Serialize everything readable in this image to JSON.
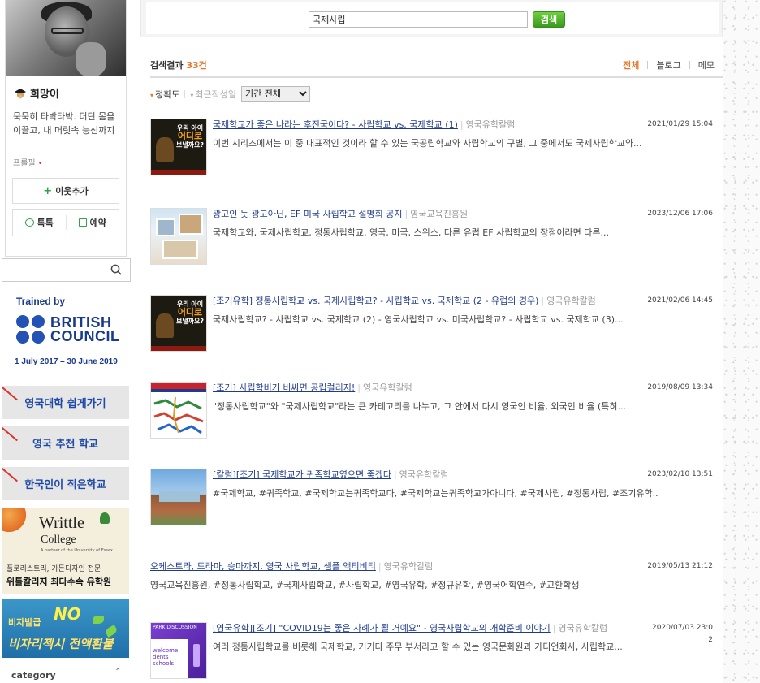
{
  "sidebar": {
    "profile": {
      "name": "희망이",
      "description": "묵묵히 타박타박. 더딘 몸을 이끌고, 내 머릿속 능선까지",
      "profile_link": "프롤필"
    },
    "buttons": {
      "add_neighbor": "이웃추가",
      "talk": "톡톡",
      "reserve": "예약"
    },
    "search": {
      "value": ""
    },
    "trained": {
      "line1": "Trained by",
      "brand1": "BRITISH",
      "brand2": "COUNCIL",
      "dates": "1 July 2017 – 30 June 2019",
      "brand_color": "#2451b4"
    },
    "links": [
      "영국대학 쉽게가기",
      "영국 추천 학교",
      "한국인이 적은학교"
    ],
    "banner_writtle": {
      "title1": "Writtle",
      "title2": "College",
      "sub": "A partner of the University of Essex",
      "line1": "플로리스트리, 가든디자인 전문",
      "line2": "위틀칼리지 최다수속 유학원"
    },
    "banner_visa": {
      "line1": "비자발급",
      "line2": "NO",
      "line3": "비자리젝시 전액환불"
    },
    "category": {
      "label": "category",
      "caret": "⌃"
    }
  },
  "search_bar": {
    "value": "국제사립",
    "button": "검색",
    "accent": "#4aa82a"
  },
  "results": {
    "label": "검색결과",
    "count": "33건",
    "tabs": [
      "전체",
      "블로그",
      "메모"
    ],
    "sort": {
      "accuracy": "정확도",
      "recent": "최근작성일",
      "period": "기간 전체"
    },
    "accent": "#e8762c"
  },
  "items": [
    {
      "title": "국제학교가 좋은 나라는 후진국이다? - 사립학교 vs. 국제학교 (1)",
      "source": "영국유학칼럼",
      "date": "2021/01/29 15:04",
      "snippet": "이번 시리즈에서는 이 중 대표적인 것이라 할 수 있는 국공립학교와 사립학교의 구별, 그 중에서도 국제사립학교와...",
      "thumb": {
        "line1": "우리 아이",
        "line2": "어디로",
        "line3": "보낼까요?"
      }
    },
    {
      "title": "광고인 듯 광고아닌, EF 미국 사립학교 설명회 공지",
      "source": "영국교육진흥원",
      "date": "2023/12/06 17:06",
      "snippet": "국제학교와, 국제사립학교, 정통사립학교, 영국, 미국, 스위스, 다른 유럽 EF 사립학교의 장점이라면 다른..."
    },
    {
      "title": "[조기유학] 정통사립학교 vs. 국제사립학교? - 사립학교 vs. 국제학교 (2 - 유럽의 경우)",
      "source": "영국유학칼럼",
      "date": "2021/02/06 14:45",
      "snippet": "국제사립학교? - 사립학교 vs. 국제학교 (2) - 영국사립학교 vs. 미국사립학교? - 사립학교 vs. 국제학교 (3)...",
      "thumb": {
        "line1": "우리 아이",
        "line2": "어디로",
        "line3": "보낼까요?"
      }
    },
    {
      "title": "[조기] 사립학비가 비싸면 공립컬리지!",
      "source": "영국유학칼럼",
      "date": "2019/08/09 13:34",
      "snippet": "\"정통사립학교\"와 \"국제사립학교\"라는 큰 카테고리를 나누고, 그 안에서 다시 영국인 비율, 외국인 비율 (특히..."
    },
    {
      "title": "[칼럼][조기] 국제학교가 귀족학교였으면 좋겠다",
      "source": "영국유학칼럼",
      "date": "2023/02/10 13:51",
      "snippet": "#국제학교, #귀족학교, #국제학교는귀족학교다, #국제학교는귀족학교가아니다, #국제사립, #정통사립, #조기유학..."
    },
    {
      "title": "오케스트라, 드라마, 승마까지. 영국 사립학교, 샘플 액티비티",
      "source": "영국유학칼럼",
      "date": "2019/05/13 21:12",
      "snippet": "영국교육진흥원, #정통사립학교, #국제사립학교, #사립학교, #영국유학, #정규유학, #영국어학연수, #교환학생"
    },
    {
      "title": "[영국유학][조기] \"COVID19는 좋은 사례가 될 거예요\" - 영국사립학교의 개학준비 이야기",
      "source": "영국유학칼럼",
      "date1": "2020/07/03 23:0",
      "date2": "2",
      "snippet": "여러 정통사립학교를 비롯해 국제학교, 거기다 주무 부서라고 할 수 있는 영국문화원과 가디언회사, 사립학교...",
      "thumb": {
        "line1": "PARK DISCUSSION",
        "line2": "welcome",
        "line3": "dents",
        "line4": "schools"
      }
    }
  ]
}
